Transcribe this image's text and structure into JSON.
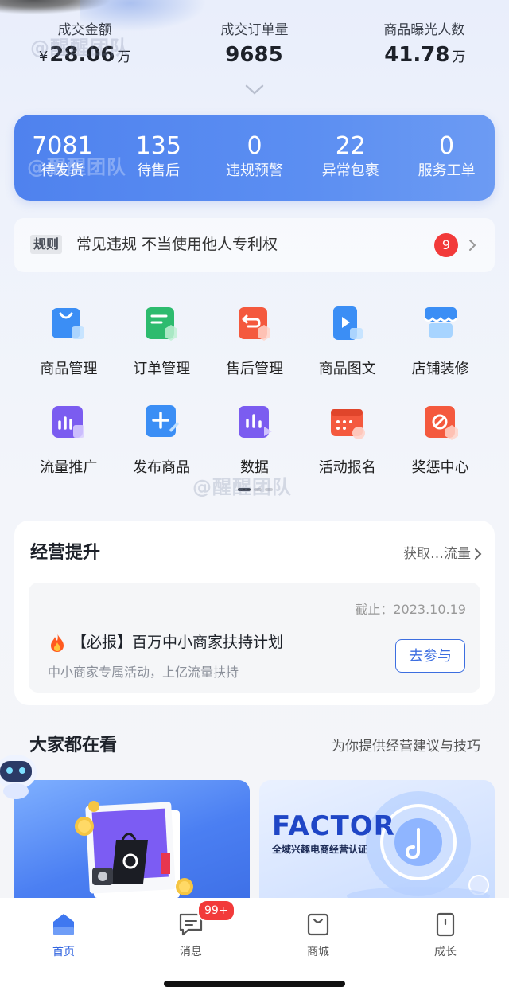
{
  "stats": [
    {
      "label": "成交金额",
      "prefix": "¥",
      "value": "28.06",
      "unit": "万"
    },
    {
      "label": "成交订单量",
      "prefix": "",
      "value": "9685",
      "unit": ""
    },
    {
      "label": "商品曝光人数",
      "prefix": "",
      "value": "41.78",
      "unit": "万"
    }
  ],
  "summary": [
    {
      "value": "7081",
      "label": "待发货"
    },
    {
      "value": "135",
      "label": "待售后"
    },
    {
      "value": "0",
      "label": "违规预警"
    },
    {
      "value": "22",
      "label": "异常包裹"
    },
    {
      "value": "0",
      "label": "服务工单"
    }
  ],
  "rules": {
    "tag": "规则",
    "text": "常见违规 不当使用他人专利权",
    "badge": "9"
  },
  "grid": [
    {
      "label": "商品管理",
      "icon": "bag-icon",
      "color": "#3b8ef5"
    },
    {
      "label": "订单管理",
      "icon": "order-icon",
      "color": "#2dbb6e"
    },
    {
      "label": "售后管理",
      "icon": "return-icon",
      "color": "#f4593e"
    },
    {
      "label": "商品图文",
      "icon": "video-doc-icon",
      "color": "#3b8ef5"
    },
    {
      "label": "店铺装修",
      "icon": "store-icon",
      "color": "#3b8ef5"
    },
    {
      "label": "流量推广",
      "icon": "traffic-icon",
      "color": "#7b5cf0"
    },
    {
      "label": "发布商品",
      "icon": "plus-icon",
      "color": "#3b8ef5"
    },
    {
      "label": "数据",
      "icon": "chart-icon",
      "color": "#7b5cf0"
    },
    {
      "label": "活动报名",
      "icon": "calendar-icon",
      "color": "#f4593e"
    },
    {
      "label": "奖惩中心",
      "icon": "prohibit-icon",
      "color": "#f4593e"
    }
  ],
  "business": {
    "title": "经营提升",
    "more": "获取…流量",
    "deadline": "截止：2023.10.19",
    "promo_title": "【必报】百万中小商家扶持计划",
    "promo_sub": "中小商家专属活动，上亿流量扶持",
    "button": "去参与"
  },
  "watch": {
    "title": "大家都在看",
    "subtitle": "为你提供经营建议与技巧"
  },
  "factor_logo": "FACTOR",
  "factor_sub": "全域兴趣电商经营认证",
  "tabs": [
    {
      "label": "首页",
      "icon": "home-icon",
      "active": true
    },
    {
      "label": "消息",
      "icon": "message-icon",
      "active": false
    },
    {
      "label": "商城",
      "icon": "shop-bag-icon",
      "active": false
    },
    {
      "label": "成长",
      "icon": "growth-icon",
      "active": false
    }
  ],
  "message_badge": "99+",
  "watermark": "@醒醒团队",
  "accent_color": "#3366e0"
}
